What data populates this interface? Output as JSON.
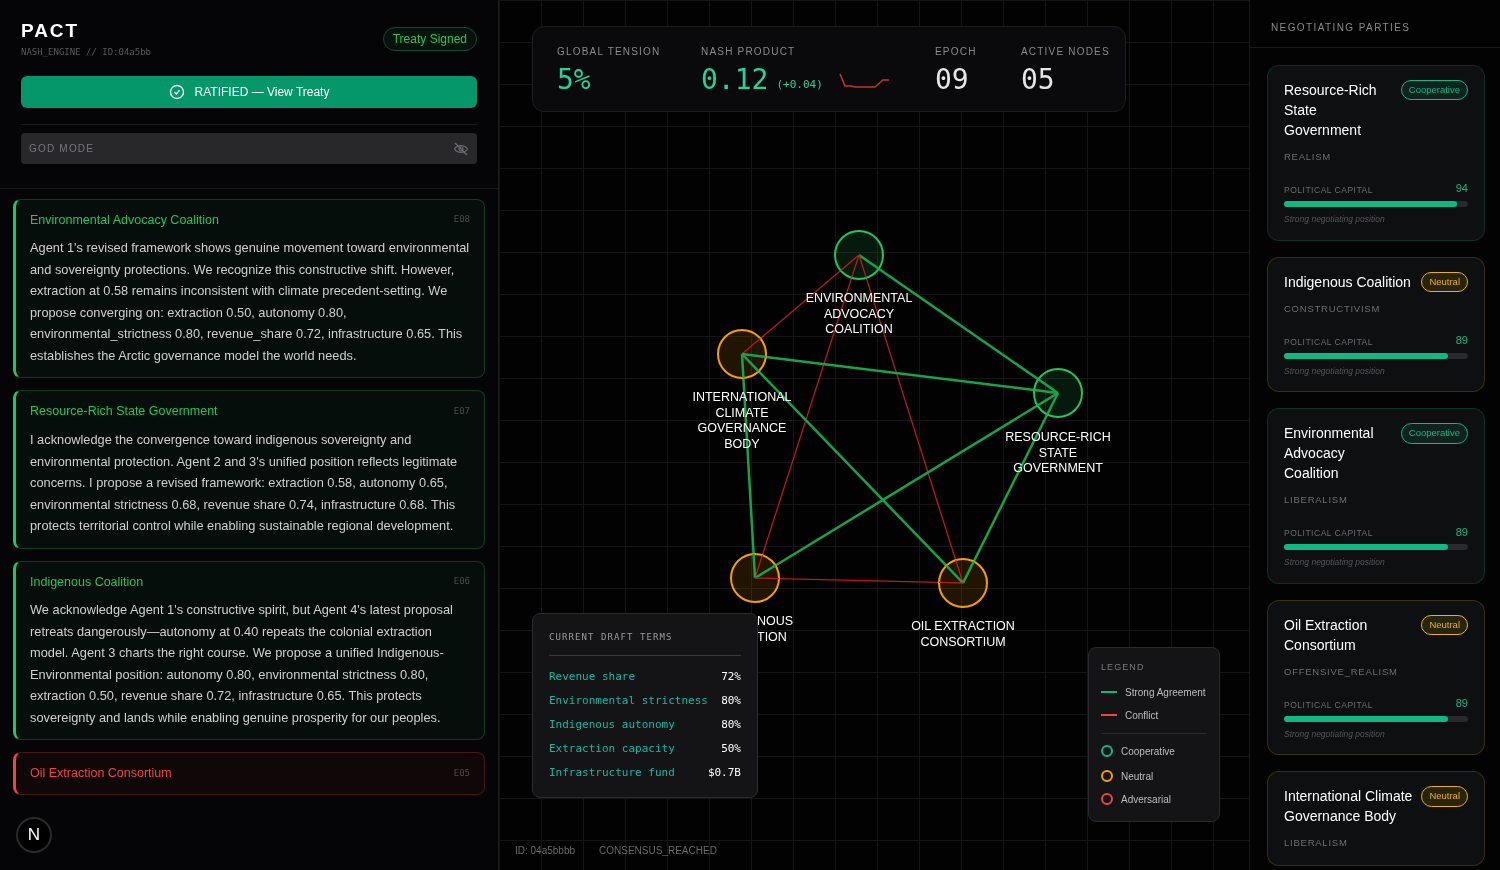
{
  "app": {
    "title": "PACT",
    "subtitle": "NASH_ENGINE // ID:04a5bb",
    "status_badge": "Treaty Signed",
    "primary_button": "RATIFIED — View Treaty",
    "god_mode": {
      "placeholder": "GOD MODE"
    }
  },
  "messages": [
    {
      "speaker": "Environmental Advocacy Coalition",
      "epoch": "E08",
      "color": "#22c55e",
      "text": "Agent 1's revised framework shows genuine movement toward environmental and sovereignty protections. We recognize this constructive shift. However, extraction at 0.58 remains inconsistent with climate precedent-setting. We propose converging on: extraction 0.50, autonomy 0.80, environmental_strictness 0.80, revenue_share 0.72, infrastructure 0.65. This establishes the Arctic governance model the world needs."
    },
    {
      "speaker": "Resource-Rich State Government",
      "epoch": "E07",
      "color": "#22c55e",
      "text": "I acknowledge the convergence toward indigenous sovereignty and environmental protection. Agent 2 and 3's unified position reflects legitimate concerns. I propose a revised framework: extraction 0.58, autonomy 0.65, environmental strictness 0.68, revenue share 0.74, infrastructure 0.68. This protects territorial control while enabling sustainable regional development."
    },
    {
      "speaker": "Indigenous Coalition",
      "epoch": "E06",
      "color": "#22c55e",
      "text": "We acknowledge Agent 1's constructive spirit, but Agent 4's latest proposal retreats dangerously—autonomy at 0.40 repeats the colonial extraction model. Agent 3 charts the right course. We propose a unified Indigenous-Environmental position: autonomy 0.80, environmental strictness 0.80, extraction 0.50, revenue share 0.72, infrastructure 0.65. This protects sovereignty and lands while enabling genuine prosperity for our peoples."
    },
    {
      "speaker": "Oil Extraction Consortium",
      "epoch": "E05",
      "color": "#ef4444"
    }
  ],
  "dev_badge": "N",
  "stats": [
    {
      "label": "GLOBAL TENSION",
      "value": "5%",
      "color": "#22d39a"
    },
    {
      "label": "NASH PRODUCT",
      "value": "0.12",
      "delta": "(+0.04)",
      "color": "#22d39a",
      "sparkline": true
    },
    {
      "label": "EPOCH",
      "value": "09",
      "color": "#e5e5e5"
    },
    {
      "label": "ACTIVE NODES",
      "value": "05",
      "color": "#e5e5e5"
    }
  ],
  "graph": {
    "nodes": [
      {
        "label": [
          "ENVIRONMENTAL",
          "ADVOCACY",
          "COALITION"
        ],
        "color": "#22c55e"
      },
      {
        "label": [
          "INTERNATIONAL",
          "CLIMATE",
          "GOVERNANCE",
          "BODY"
        ],
        "color": "#f59e0b"
      },
      {
        "label": [
          "RESOURCE-RICH",
          "STATE",
          "GOVERNMENT"
        ],
        "color": "#22c55e"
      },
      {
        "label": [
          "NOUS",
          "TION"
        ],
        "color": "#f59e0b"
      },
      {
        "label": [
          "OIL EXTRACTION",
          "CONSORTIUM"
        ],
        "color": "#f59e0b"
      }
    ],
    "edges": [
      {
        "kind": "conflict",
        "color": "#b91c1c"
      },
      {
        "kind": "agreement",
        "color": "#16a34a"
      },
      {
        "kind": "conflict",
        "color": "#b91c1c"
      },
      {
        "kind": "conflict",
        "color": "#b91c1c"
      },
      {
        "kind": "agreement",
        "color": "#16a34a"
      },
      {
        "kind": "agreement",
        "color": "#16a34a"
      },
      {
        "kind": "agreement",
        "color": "#16a34a"
      },
      {
        "kind": "agreement",
        "color": "#16a34a"
      },
      {
        "kind": "agreement",
        "color": "#16a34a"
      },
      {
        "kind": "conflict",
        "color": "#b91c1c"
      }
    ]
  },
  "draft_terms": {
    "title": "CURRENT DRAFT TERMS",
    "rows": [
      {
        "label": "Revenue share",
        "value": "72%"
      },
      {
        "label": "Environmental strictness",
        "value": "80%"
      },
      {
        "label": "Indigenous autonomy",
        "value": "80%"
      },
      {
        "label": "Extraction capacity",
        "value": "50%"
      },
      {
        "label": "Infrastructure fund",
        "value": "$0.7B"
      }
    ]
  },
  "legend": {
    "title": "LEGEND",
    "items": [
      {
        "kind": "line",
        "label": "Strong Agreement",
        "color": "#10b981"
      },
      {
        "kind": "line",
        "label": "Conflict",
        "color": "#ef4444"
      },
      {
        "kind": "ring",
        "label": "Cooperative",
        "color": "#10b981"
      },
      {
        "kind": "ring",
        "label": "Neutral",
        "color": "#f59e0b"
      },
      {
        "kind": "ring",
        "label": "Adversarial",
        "color": "#ef4444"
      }
    ]
  },
  "footer": {
    "id": "ID: 04a5bbbb",
    "status": "CONSENSUS_REACHED"
  },
  "parties": {
    "title": "NEGOTIATING PARTIES",
    "items": [
      {
        "name": "Resource-Rich State Government",
        "color": "#10b981",
        "badge": "Cooperative",
        "ideology": "REALISM",
        "capital_label": "POLITICAL CAPITAL",
        "capital": "94",
        "level": 0.94,
        "note": "Strong negotiating position"
      },
      {
        "name": "Indigenous Coalition",
        "color": "#eab308",
        "badge": "Neutral",
        "ideology": "CONSTRUCTIVISM",
        "capital_label": "POLITICAL CAPITAL",
        "capital": "89",
        "level": 0.89,
        "note": "Strong negotiating position"
      },
      {
        "name": "Environmental Advocacy Coalition",
        "color": "#10b981",
        "badge": "Cooperative",
        "ideology": "LIBERALISM",
        "capital_label": "POLITICAL CAPITAL",
        "capital": "89",
        "level": 0.89,
        "note": "Strong negotiating position"
      },
      {
        "name": "Oil Extraction Consortium",
        "color": "#eab308",
        "badge": "Neutral",
        "ideology": "OFFENSIVE_REALISM",
        "capital_label": "POLITICAL CAPITAL",
        "capital": "89",
        "level": 0.89,
        "note": "Strong negotiating position"
      },
      {
        "name": "International Climate Governance Body",
        "color": "#eab308",
        "badge": "Neutral",
        "ideology": "LIBERALISM"
      }
    ]
  }
}
